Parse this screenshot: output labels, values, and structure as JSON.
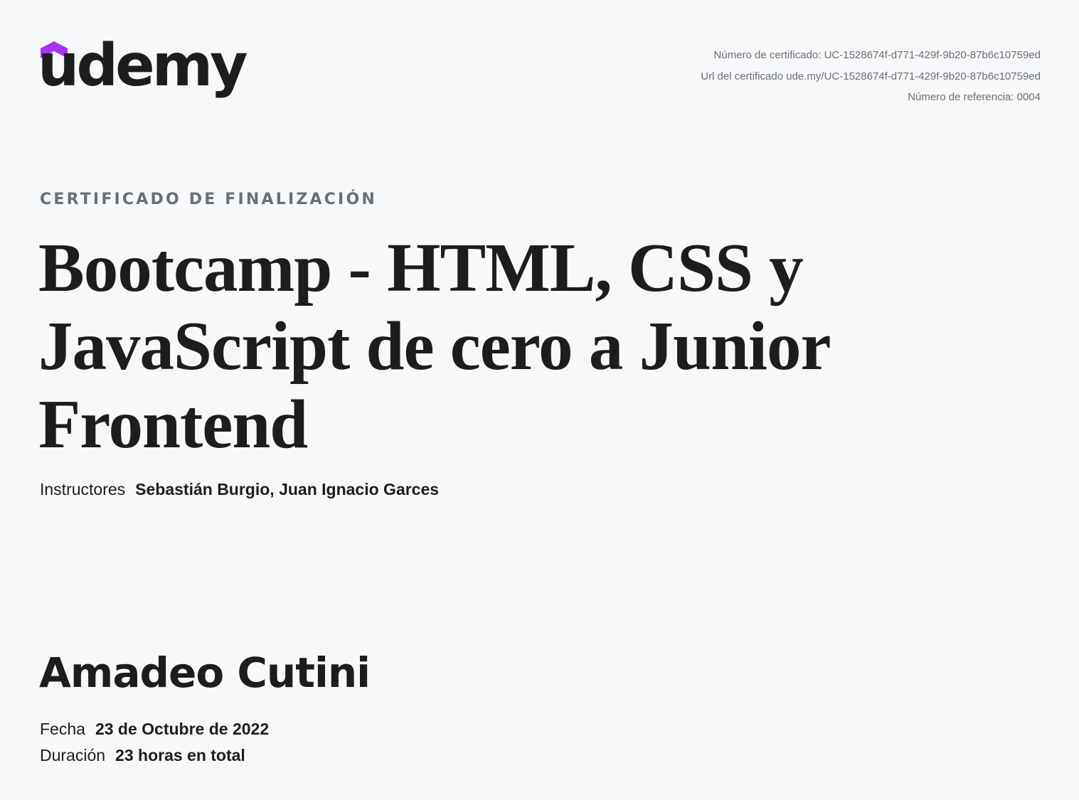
{
  "brand": {
    "name": "udemy",
    "accent_color": "#a435f0",
    "text_color": "#1c1d1f"
  },
  "certificate_meta": {
    "number_line": "Número de certificado: UC-1528674f-d771-429f-9b20-87b6c10759ed",
    "url_line": "Url del certificado ude.my/UC-1528674f-d771-429f-9b20-87b6c10759ed",
    "reference_line": "Número de referencia: 0004"
  },
  "kicker": "CERTIFICADO DE FINALIZACIÓN",
  "course_title": "Bootcamp - HTML, CSS y JavaScript de cero a Junior Frontend",
  "instructors": {
    "label": "Instructores",
    "names": "Sebastián Burgio,  Juan Ignacio Garces"
  },
  "student_name": "Amadeo Cutini",
  "date": {
    "label": "Fecha",
    "value": "23 de Octubre de 2022"
  },
  "duration": {
    "label": "Duración",
    "value": "23 horas en total"
  }
}
